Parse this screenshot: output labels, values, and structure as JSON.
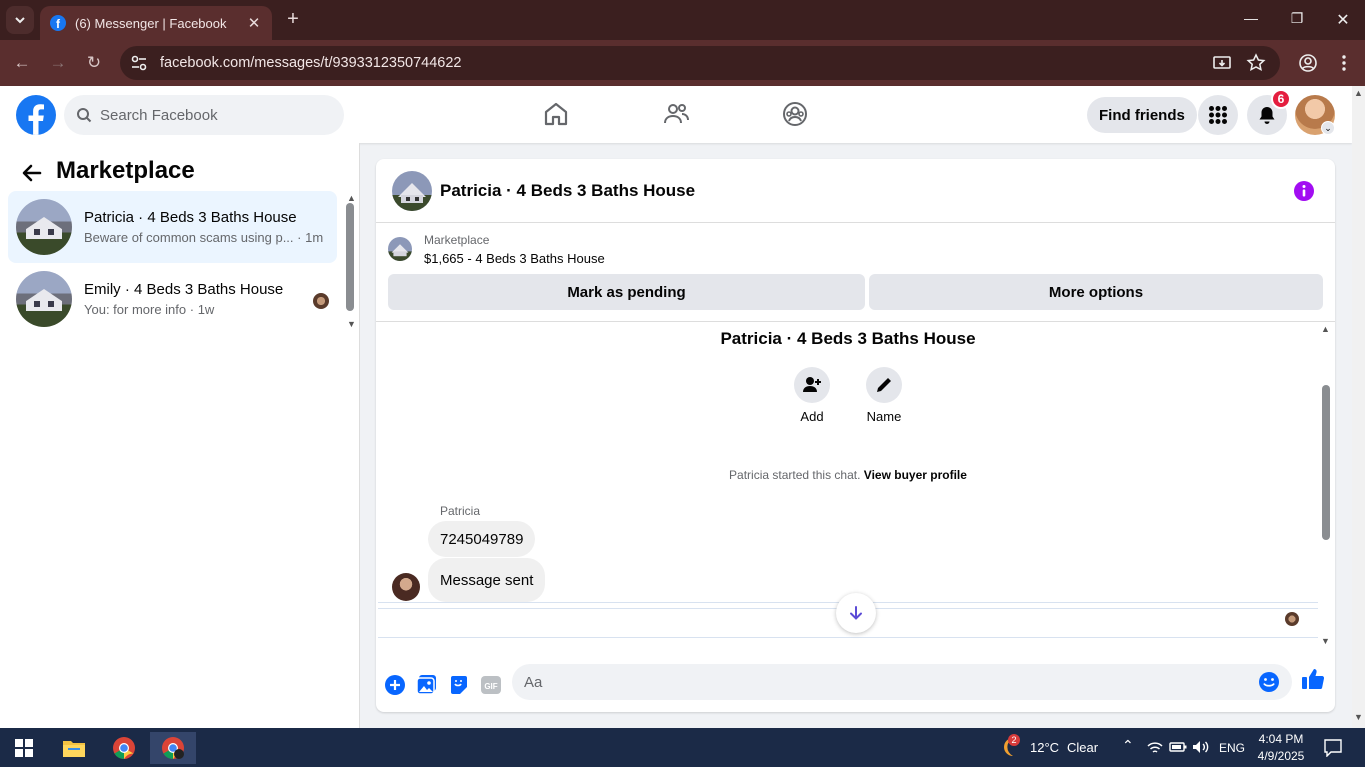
{
  "browser": {
    "tab_title": "(6) Messenger | Facebook",
    "url": "facebook.com/messages/t/9393312350744622"
  },
  "header": {
    "search_placeholder": "Search Facebook",
    "find_friends": "Find friends",
    "notification_count": "6",
    "brand_color": "#1877f2"
  },
  "sidebar": {
    "title": "Marketplace",
    "conversations": [
      {
        "name": "Patricia · 4 Beds 3 Baths House",
        "preview": "Beware of common scams using p...",
        "time": "· 1m"
      },
      {
        "name": "Emily · 4 Beds 3 Baths House",
        "preview": "You: for more info",
        "time": "· 1w"
      }
    ]
  },
  "chat": {
    "title": "Patricia · 4 Beds 3 Baths House",
    "marketplace_label": "Marketplace",
    "listing": "$1,665 - 4 Beds 3 Baths House",
    "mark_pending": "Mark as pending",
    "more_options": "More options",
    "conversation_title": "Patricia · 4 Beds 3 Baths House",
    "actions": {
      "add": "Add",
      "name": "Name"
    },
    "started_text": "Patricia started this chat.",
    "buyer_profile_link": "View buyer profile",
    "sender": "Patricia",
    "messages": [
      "7245049789",
      "Message sent"
    ],
    "input_placeholder": "Aa"
  },
  "taskbar": {
    "weather_badge": "2",
    "weather": "12°C",
    "weather_status": "Clear",
    "language": "ENG",
    "time": "4:04 PM",
    "date": "4/9/2025"
  }
}
